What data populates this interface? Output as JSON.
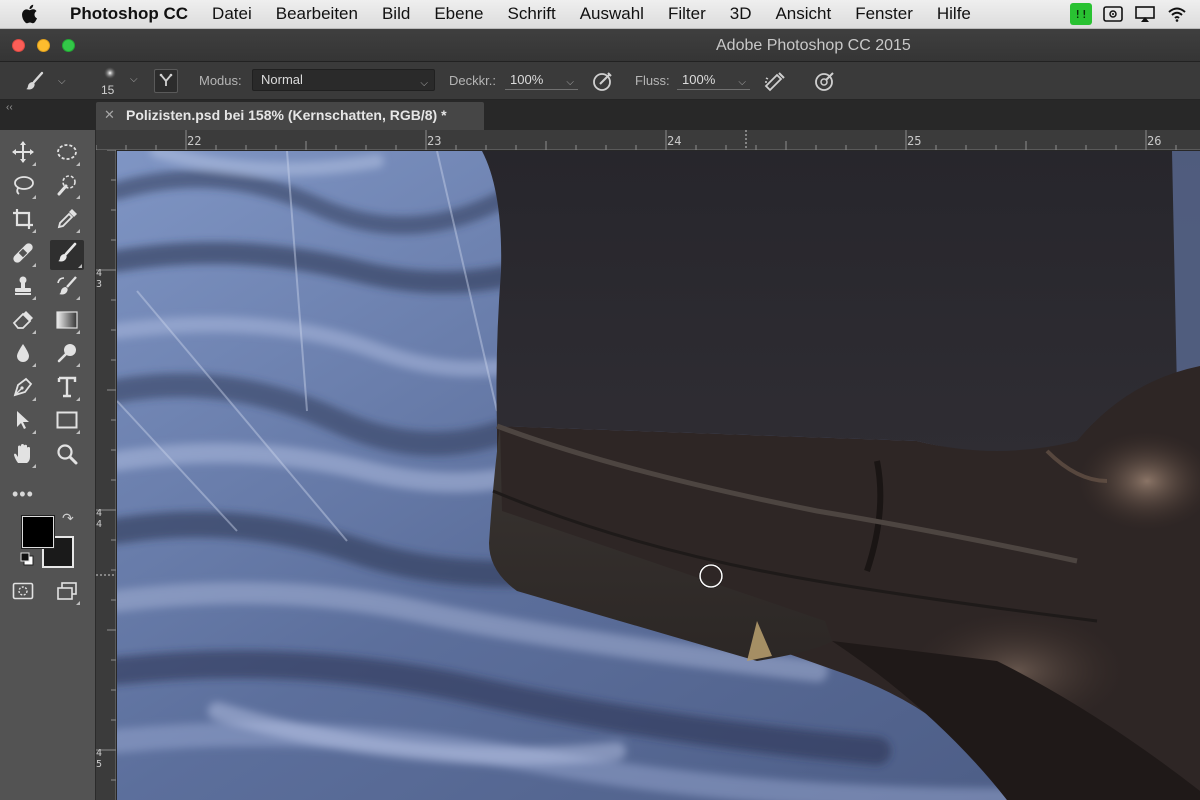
{
  "menubar": {
    "app_name": "Photoshop CC",
    "items": [
      "Datei",
      "Bearbeiten",
      "Bild",
      "Ebene",
      "Schrift",
      "Auswahl",
      "Filter",
      "3D",
      "Ansicht",
      "Fenster",
      "Hilfe"
    ]
  },
  "window": {
    "title": "Adobe Photoshop CC 2015"
  },
  "options": {
    "brush_size": "15",
    "mode_label": "Modus:",
    "mode_value": "Normal",
    "opacity_label": "Deckkr.:",
    "opacity_value": "100%",
    "flow_label": "Fluss:",
    "flow_value": "100%"
  },
  "document": {
    "tab_title": "Polizisten.psd bei 158% (Kernschatten, RGB/8) *"
  },
  "ruler": {
    "top_labels": [
      "22",
      "23",
      "24",
      "25",
      "26"
    ],
    "left_labels": [
      [
        "4",
        "3"
      ],
      [
        "4",
        "4"
      ],
      [
        "4",
        "5"
      ]
    ]
  },
  "colors": {
    "menubar_bg": "#e5e5e5",
    "chrome_dark": "#3a3a3a",
    "toolbox_bg": "#535353",
    "foreground": "#000000",
    "background": "#1a1a1a"
  },
  "tools": [
    "move-icon",
    "marquee-icon",
    "lasso-icon",
    "quick-selection-icon",
    "crop-icon",
    "eyedropper-icon",
    "healing-brush-icon",
    "brush-icon",
    "clone-stamp-icon",
    "history-brush-icon",
    "eraser-icon",
    "gradient-icon",
    "blur-icon",
    "dodge-icon",
    "pen-icon",
    "type-icon",
    "path-selection-icon",
    "rectangle-icon",
    "hand-icon",
    "zoom-icon"
  ]
}
